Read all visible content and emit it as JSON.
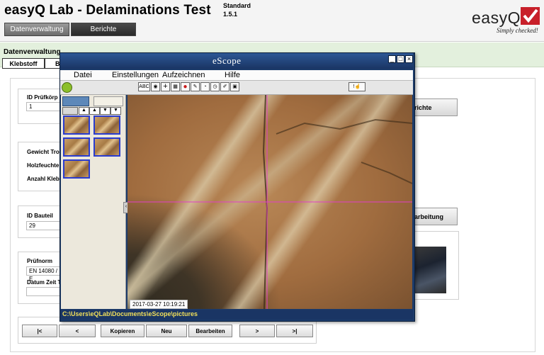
{
  "header": {
    "title": "easyQ Lab - Delaminations Test",
    "edition": "Standard",
    "version": "1.5.1",
    "nav_buttons": [
      "Datenverwaltung",
      "Berichte"
    ],
    "logo": {
      "text": "easyQ",
      "tagline": "Simply checked!"
    }
  },
  "section": {
    "title": "Datenverwaltung",
    "tabs": [
      "Klebstoff",
      "B"
    ]
  },
  "form": {
    "id_pruefkoerper_label": "ID Prüfkörp",
    "id_pruefkoerper_value": "1",
    "gewicht_label": "Gewicht Troc",
    "holzfeuchte_label": "Holzfeuchte",
    "anzahl_label": "Anzahl Klebs",
    "id_bauteil_label": "ID Bauteil",
    "id_bauteil_value": "29",
    "pruefnorm_label": "Prüfnorm",
    "pruefnorm_value": "EN 14080 / E",
    "datum_label": "Datum Zeit T",
    "datum_value": "",
    "right_btn_1": "richte",
    "right_btn_2": "arbeitung",
    "right_label": "e"
  },
  "nav": {
    "first": "|<",
    "prev": "<",
    "kopieren": "Kopieren",
    "neu": "Neu",
    "bearbeiten": "Bearbeiten",
    "next": ">",
    "last": ">|"
  },
  "escope": {
    "title": "eScope",
    "menu": [
      "Datei",
      "Einstellungen",
      "Aufzeichnen",
      "Hilfe"
    ],
    "toolbar_text": "ABC",
    "timestamp": "2017-03-27 10:19:21",
    "path": "C:\\Users\\eQLab\\Documents\\eScope\\pictures",
    "thumbnails": 5
  }
}
